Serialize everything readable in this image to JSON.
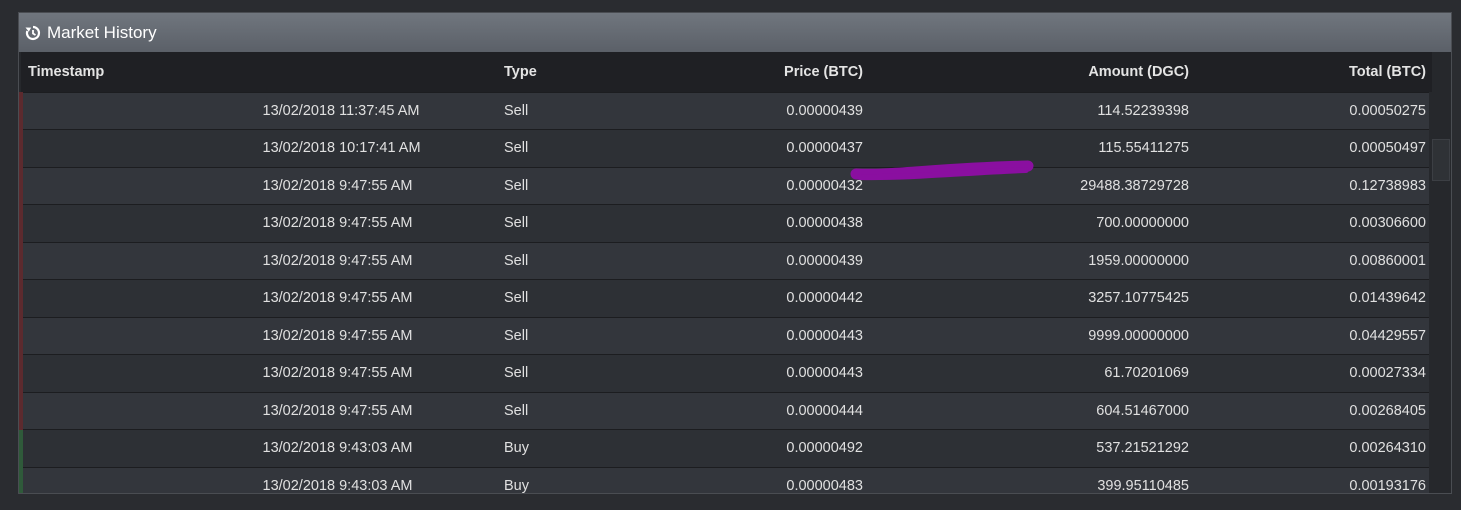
{
  "panel": {
    "title": "Market History",
    "icon": "history-icon"
  },
  "columns": {
    "timestamp": "Timestamp",
    "type": "Type",
    "price": "Price (BTC)",
    "amount": "Amount (DGC)",
    "total": "Total (BTC)"
  },
  "rows": [
    {
      "timestamp": "13/02/2018 11:37:45 AM",
      "type": "Sell",
      "price": "0.00000439",
      "amount": "114.52239398",
      "total": "0.00050275"
    },
    {
      "timestamp": "13/02/2018 10:17:41 AM",
      "type": "Sell",
      "price": "0.00000437",
      "amount": "115.55411275",
      "total": "0.00050497"
    },
    {
      "timestamp": "13/02/2018 9:47:55 AM",
      "type": "Sell",
      "price": "0.00000432",
      "amount": "29488.38729728",
      "total": "0.12738983"
    },
    {
      "timestamp": "13/02/2018 9:47:55 AM",
      "type": "Sell",
      "price": "0.00000438",
      "amount": "700.00000000",
      "total": "0.00306600"
    },
    {
      "timestamp": "13/02/2018 9:47:55 AM",
      "type": "Sell",
      "price": "0.00000439",
      "amount": "1959.00000000",
      "total": "0.00860001"
    },
    {
      "timestamp": "13/02/2018 9:47:55 AM",
      "type": "Sell",
      "price": "0.00000442",
      "amount": "3257.10775425",
      "total": "0.01439642"
    },
    {
      "timestamp": "13/02/2018 9:47:55 AM",
      "type": "Sell",
      "price": "0.00000443",
      "amount": "9999.00000000",
      "total": "0.04429557"
    },
    {
      "timestamp": "13/02/2018 9:47:55 AM",
      "type": "Sell",
      "price": "0.00000443",
      "amount": "61.70201069",
      "total": "0.00027334"
    },
    {
      "timestamp": "13/02/2018 9:47:55 AM",
      "type": "Sell",
      "price": "0.00000444",
      "amount": "604.51467000",
      "total": "0.00268405"
    },
    {
      "timestamp": "13/02/2018 9:43:03 AM",
      "type": "Buy",
      "price": "0.00000492",
      "amount": "537.21521292",
      "total": "0.00264310"
    },
    {
      "timestamp": "13/02/2018 9:43:03 AM",
      "type": "Buy",
      "price": "0.00000483",
      "amount": "399.95110485",
      "total": "0.00193176"
    }
  ],
  "colors": {
    "sell_marker": "#5c2a2e",
    "buy_marker": "#2f5a3a",
    "scribble": "#8a0fa0"
  }
}
